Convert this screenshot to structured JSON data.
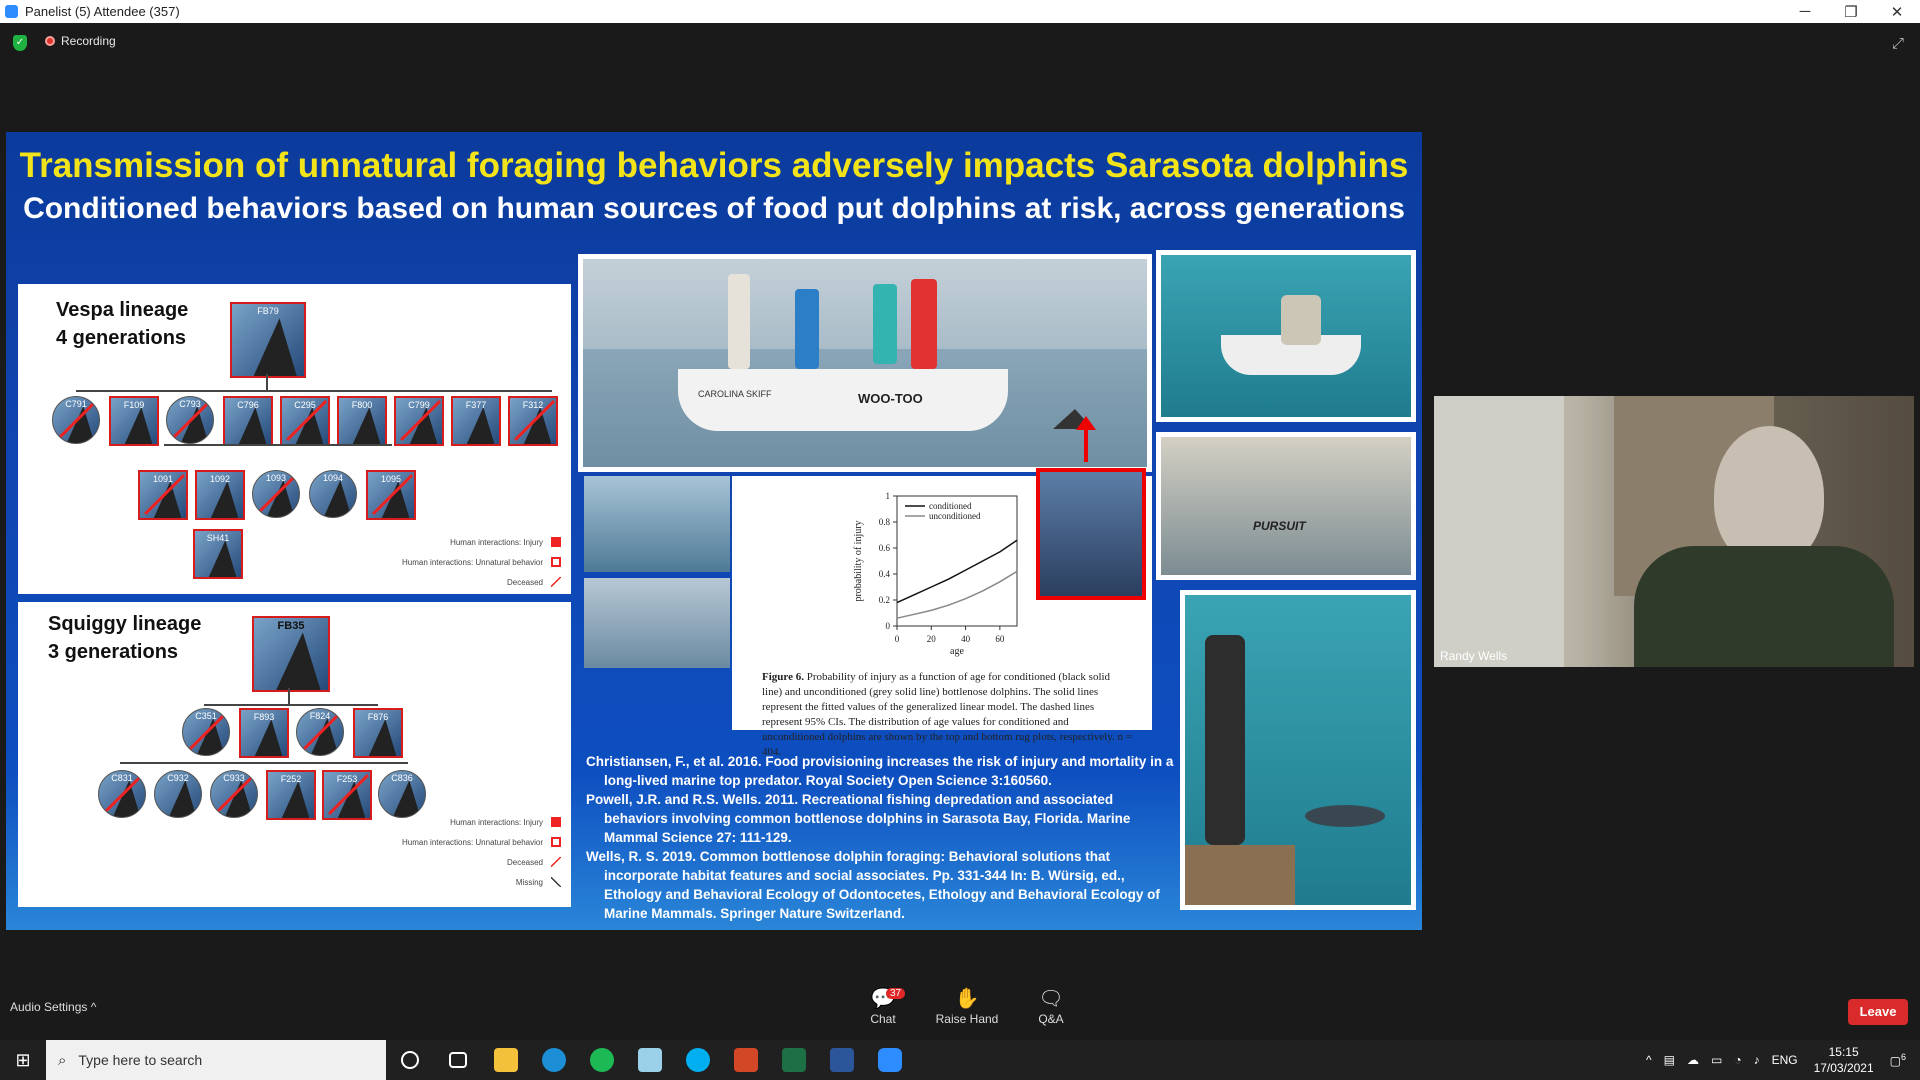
{
  "window": {
    "title": "Panelist (5) Attendee (357)",
    "minimize": "─",
    "restore": "❐",
    "close": "✕"
  },
  "meeting": {
    "recording_label": "Recording",
    "expand_icon": "⤢",
    "shield_glyph": "✓"
  },
  "slide": {
    "title": "Transmission of unnatural foraging behaviors adversely impacts Sarasota dolphins",
    "subtitle": "Conditioned behaviors based on human sources of food put dolphins at risk, across generations",
    "vespa": {
      "title_line1": "Vespa lineage",
      "title_line2": "4 generations",
      "root_id": "FB79",
      "gen2_ids": [
        "C791",
        "F109",
        "C793",
        "C796",
        "C295",
        "F800",
        "C799",
        "F377",
        "F312"
      ],
      "gen3_ids": [
        "1091",
        "1092",
        "1093",
        "1094",
        "1095"
      ],
      "gen4_ids": [
        "SH41"
      ],
      "legend": [
        "Human interactions: Injury",
        "Human interactions: Unnatural behavior",
        "Deceased"
      ]
    },
    "squiggy": {
      "title_line1": "Squiggy lineage",
      "title_line2": "3 generations",
      "root_id": "FB35",
      "gen2_ids": [
        "C351",
        "F893",
        "F824",
        "F876"
      ],
      "gen3_ids": [
        "C831",
        "C932",
        "C933",
        "F252",
        "F253",
        "C836"
      ],
      "legend": [
        "Human interactions: Injury",
        "Human interactions: Unnatural behavior",
        "Deceased",
        "Missing"
      ]
    },
    "boat_name": "WOO-TOO",
    "boat_brand": "CAROLINA SKIFF",
    "pursuit_label": "PURSUIT",
    "figure_caption_bold": "Figure 6.",
    "figure_caption": "Probability of injury as a function of age for conditioned (black solid line) and unconditioned (grey solid line) bottlenose dolphins. The solid lines represent the fitted values of the generalized linear model. The dashed lines represent 95% CIs. The distribution of age values for conditioned and unconditioned dolphins are shown by the top and bottom rug plots, respectively. n = 404.",
    "references": [
      "Christiansen, F., et al. 2016. Food provisioning increases the risk of injury and mortality in a long-lived marine top predator. Royal Society Open Science 3:160560.",
      "Powell, J.R. and R.S. Wells. 2011. Recreational fishing depredation and associated behaviors involving common bottlenose dolphins in Sarasota Bay, Florida. Marine Mammal Science 27: 111-129.",
      "Wells, R. S. 2019. Common bottlenose dolphin foraging: Behavioral solutions that incorporate habitat features and social associates. Pp. 331-344 In: B. Würsig, ed., Ethology and Behavioral Ecology of Odontocetes, Ethology and Behavioral Ecology of Marine Mammals. Springer Nature Switzerland."
    ]
  },
  "chart_data": {
    "type": "line",
    "xlabel": "age",
    "ylabel": "probability of injury",
    "xlim": [
      0,
      70
    ],
    "ylim": [
      0,
      1.0
    ],
    "xticks": [
      0,
      20,
      40,
      60
    ],
    "yticks": [
      0,
      0.2,
      0.4,
      0.6,
      0.8,
      1.0
    ],
    "legend_position": "top-left",
    "series": [
      {
        "name": "conditioned",
        "color": "#111111",
        "style": "solid",
        "x": [
          0,
          10,
          20,
          30,
          40,
          50,
          60,
          72
        ],
        "values": [
          0.18,
          0.24,
          0.3,
          0.36,
          0.43,
          0.5,
          0.57,
          0.66
        ]
      },
      {
        "name": "unconditioned",
        "color": "#888888",
        "style": "solid",
        "x": [
          0,
          10,
          20,
          30,
          40,
          50,
          60,
          72
        ],
        "values": [
          0.06,
          0.09,
          0.12,
          0.16,
          0.21,
          0.27,
          0.34,
          0.42
        ]
      }
    ]
  },
  "video": {
    "participant_name": "Randy Wells"
  },
  "controls": {
    "audio_settings": "Audio Settings",
    "audio_caret": "^",
    "chat_label": "Chat",
    "chat_count": "37",
    "raise_hand_label": "Raise Hand",
    "qa_label": "Q&A",
    "leave_label": "Leave"
  },
  "taskbar": {
    "search_placeholder": "Type here to search",
    "language": "ENG",
    "time": "15:15",
    "date": "17/03/2021",
    "notification_count": "6"
  }
}
